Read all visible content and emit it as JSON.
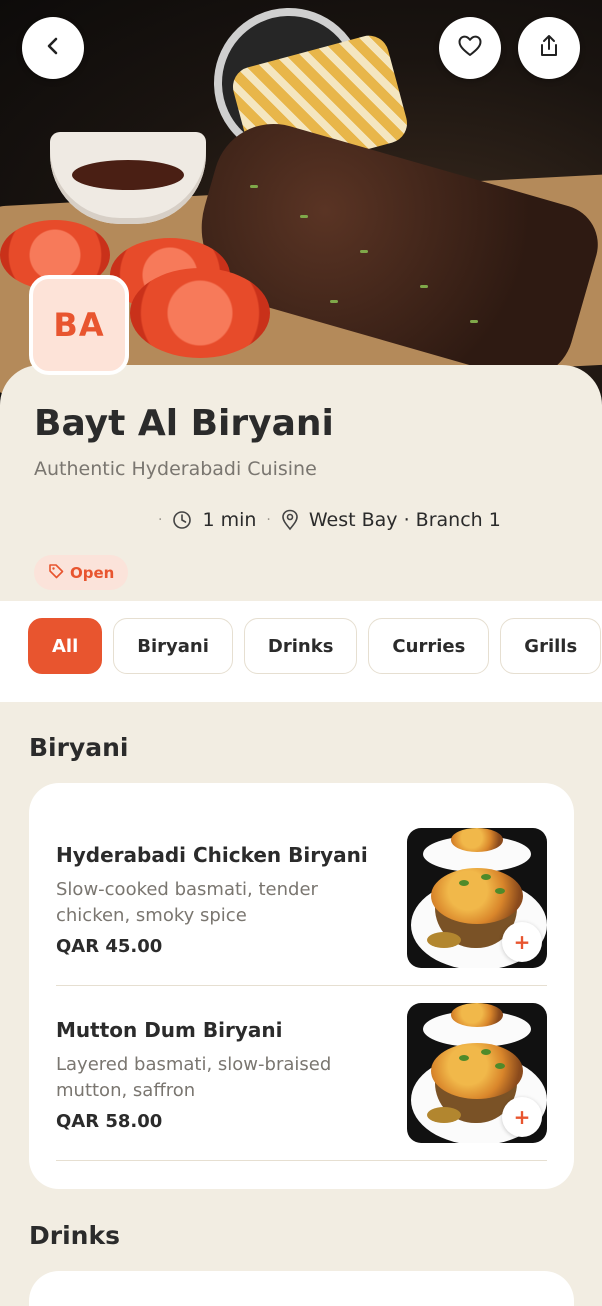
{
  "header": {
    "back_icon": "chevron-left-icon",
    "favorite_icon": "heart-icon",
    "share_icon": "share-icon"
  },
  "restaurant": {
    "logo_text": "BA",
    "name": "Bayt Al Biryani",
    "tagline": "Authentic Hyderabadi Cuisine",
    "separator": "·",
    "delivery_time": "1 min",
    "location": "West Bay · Branch 1",
    "status": "Open"
  },
  "categories": [
    "All",
    "Biryani",
    "Drinks",
    "Curries",
    "Grills"
  ],
  "active_category": "All",
  "sections": [
    {
      "title": "Biryani",
      "items": [
        {
          "name": "Hyderabadi Chicken Biryani",
          "description": "Slow-cooked basmati, tender chicken, smoky spice",
          "price": "QAR 45.00",
          "add_label": "+"
        },
        {
          "name": "Mutton Dum Biryani",
          "description": "Layered basmati, slow-braised mutton, saffron",
          "price": "QAR 58.00",
          "add_label": "+"
        }
      ]
    },
    {
      "title": "Drinks",
      "items": []
    }
  ],
  "colors": {
    "accent": "#e8552f",
    "background": "#f2ede2",
    "card": "#ffffff",
    "text": "#2b2b2b",
    "muted": "#7a7670"
  }
}
